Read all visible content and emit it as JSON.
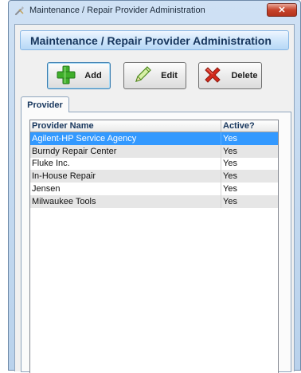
{
  "window": {
    "title": "Maintenance / Repair Provider Administration",
    "close_glyph": "✕"
  },
  "banner": {
    "title": "Maintenance / Repair Provider Administration"
  },
  "toolbar": {
    "add_label": "Add",
    "edit_label": "Edit",
    "delete_label": "Delete"
  },
  "tabs": [
    {
      "label": "Provider",
      "selected": true
    }
  ],
  "grid": {
    "columns": [
      "Provider Name",
      "Active?"
    ],
    "rows": [
      {
        "name": "Agilent-HP Service Agency",
        "active": "Yes",
        "selected": true
      },
      {
        "name": "Burndy Repair Center",
        "active": "Yes"
      },
      {
        "name": "Fluke Inc.",
        "active": "Yes"
      },
      {
        "name": "In-House Repair",
        "active": "Yes"
      },
      {
        "name": "Jensen",
        "active": "Yes"
      },
      {
        "name": "Milwaukee Tools",
        "active": "Yes"
      }
    ]
  },
  "icons": {
    "app": "wrench-icon",
    "add": "green-plus-icon",
    "edit": "pencil-icon",
    "delete": "red-x-icon"
  },
  "colors": {
    "selection": "#3399ff",
    "banner_text": "#17365d",
    "add_green": "#3fae2a",
    "delete_red": "#d42a1c"
  }
}
